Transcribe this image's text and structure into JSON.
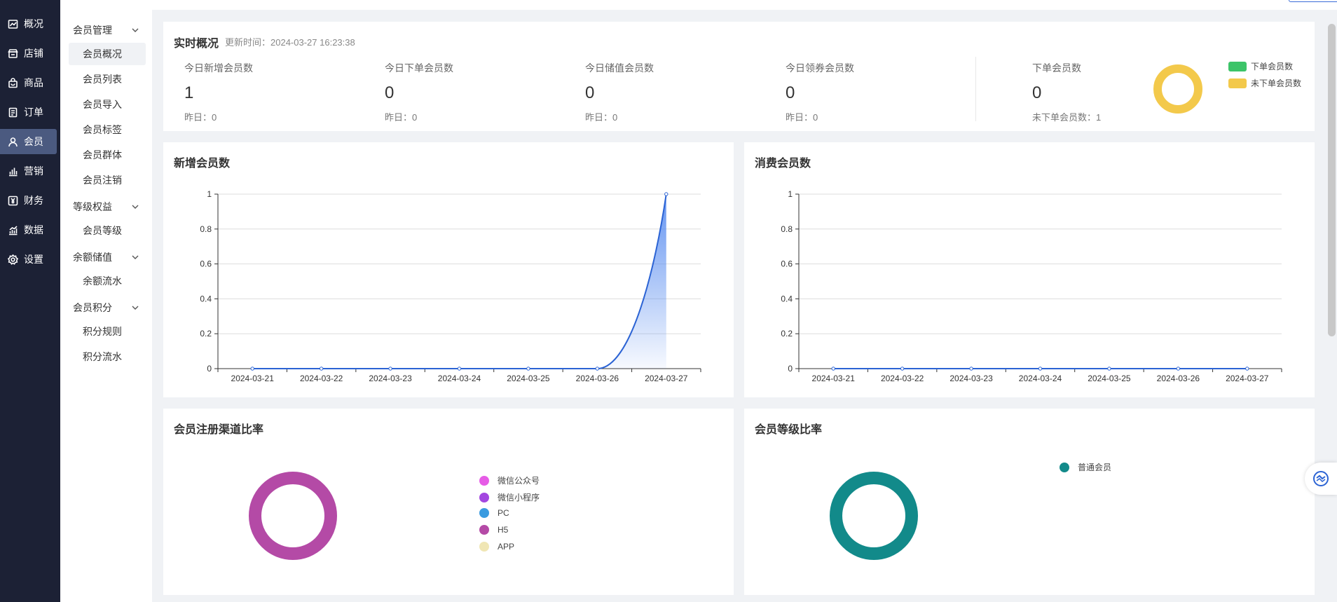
{
  "nav": {
    "items": [
      {
        "label": "概况",
        "icon": "chart-line-icon"
      },
      {
        "label": "店铺",
        "icon": "store-icon"
      },
      {
        "label": "商品",
        "icon": "bag-icon"
      },
      {
        "label": "订单",
        "icon": "document-icon"
      },
      {
        "label": "会员",
        "icon": "user-icon"
      },
      {
        "label": "营销",
        "icon": "bar-chart-icon"
      },
      {
        "label": "财务",
        "icon": "yen-icon"
      },
      {
        "label": "数据",
        "icon": "analytics-icon"
      },
      {
        "label": "设置",
        "icon": "gear-icon"
      }
    ],
    "active": "会员"
  },
  "submenu": {
    "groups": [
      {
        "label": "会员管理",
        "items": [
          "会员概况",
          "会员列表",
          "会员导入",
          "会员标签",
          "会员群体",
          "会员注销"
        ]
      },
      {
        "label": "等级权益",
        "items": [
          "会员等级"
        ]
      },
      {
        "label": "余额储值",
        "items": [
          "余额流水"
        ]
      },
      {
        "label": "会员积分",
        "items": [
          "积分规则",
          "积分流水"
        ]
      }
    ],
    "active": "会员概况"
  },
  "realtime": {
    "title": "实时概况",
    "update_label": "更新时间：",
    "update_time": "2024-03-27 16:23:38",
    "stats": [
      {
        "label": "今日新增会员数",
        "value": "1",
        "yesterday": "昨日：0"
      },
      {
        "label": "今日下单会员数",
        "value": "0",
        "yesterday": "昨日：0"
      },
      {
        "label": "今日储值会员数",
        "value": "0",
        "yesterday": "昨日：0"
      },
      {
        "label": "今日领券会员数",
        "value": "0",
        "yesterday": "昨日：0"
      }
    ],
    "order_stat": {
      "label": "下单会员数",
      "value": "0",
      "sub": "未下单会员数：1"
    },
    "donut_legend": [
      {
        "label": "下单会员数",
        "color": "#3cc468"
      },
      {
        "label": "未下单会员数",
        "color": "#f3c94b"
      }
    ],
    "donut_color": "#f3c94b"
  },
  "new_members": {
    "title": "新增会员数",
    "chart_data": {
      "type": "area",
      "x": [
        "2024-03-21",
        "2024-03-22",
        "2024-03-23",
        "2024-03-24",
        "2024-03-25",
        "2024-03-26",
        "2024-03-27"
      ],
      "values": [
        0,
        0,
        0,
        0,
        0,
        0,
        1
      ],
      "yticks": [
        "0",
        "0.2",
        "0.4",
        "0.6",
        "0.8",
        "1"
      ],
      "ylim": [
        0,
        1
      ],
      "grid": true,
      "color": "#2b63d4"
    }
  },
  "consume_members": {
    "title": "消费会员数",
    "chart_data": {
      "type": "line",
      "x": [
        "2024-03-21",
        "2024-03-22",
        "2024-03-23",
        "2024-03-24",
        "2024-03-25",
        "2024-03-26",
        "2024-03-27"
      ],
      "values": [
        0,
        0,
        0,
        0,
        0,
        0,
        0
      ],
      "yticks": [
        "0",
        "0.2",
        "0.4",
        "0.6",
        "0.8",
        "1"
      ],
      "ylim": [
        0,
        1
      ],
      "grid": true,
      "color": "#2b63d4"
    }
  },
  "channel": {
    "title": "会员注册渠道比率",
    "legend": [
      {
        "label": "微信公众号",
        "color": "#e65ce6"
      },
      {
        "label": "微信小程序",
        "color": "#a347e0"
      },
      {
        "label": "PC",
        "color": "#3a9be0"
      },
      {
        "label": "H5",
        "color": "#b44aa6"
      },
      {
        "label": "APP",
        "color": "#f0e6b4"
      }
    ],
    "donut_color": "#b44aa6"
  },
  "level": {
    "title": "会员等级比率",
    "legend": [
      {
        "label": "普通会员",
        "color": "#128a8a"
      }
    ],
    "donut_color": "#128a8a"
  }
}
